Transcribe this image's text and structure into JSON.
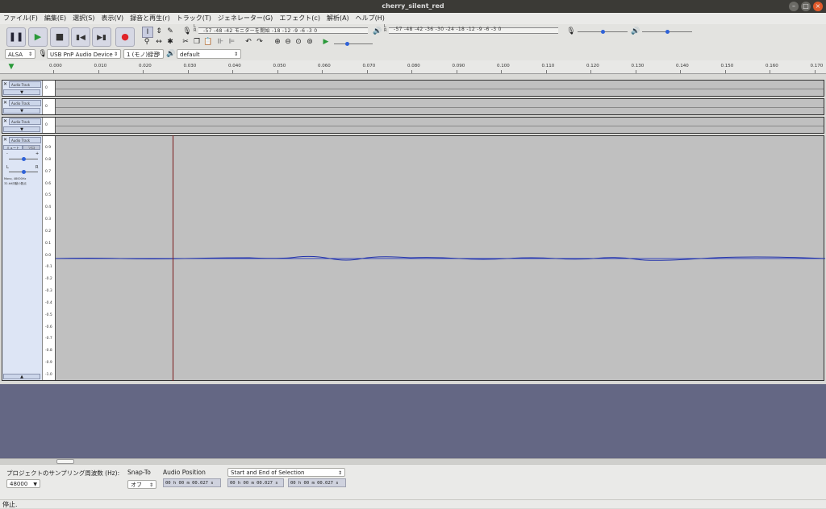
{
  "window": {
    "title": "cherry_silent_red"
  },
  "menu": [
    "ファイル(F)",
    "編集(E)",
    "選択(S)",
    "表示(V)",
    "録音と再生(r)",
    "トラック(T)",
    "ジェネレーター(G)",
    "エフェクト(c)",
    "解析(A)",
    "ヘルプ(H)"
  ],
  "meters": {
    "record_scale": "-57  -48  -42  モニターを開始  -18  -12 -9 -6 -3 0",
    "playback_scale": "-57  -48  -42  -36  -30  -24  -18  -12 -9 -6 -3 0",
    "record_level": 0.5,
    "playback_level": 0.5,
    "lr_label": "L\nR"
  },
  "device": {
    "host": "ALSA",
    "recording_device": "USB PnP Audio Device",
    "channels": "1 (モノ)録音",
    "playback_device": "default"
  },
  "ruler": [
    "0.000",
    "0.010",
    "0.020",
    "0.030",
    "0.040",
    "0.050",
    "0.060",
    "0.070",
    "0.080",
    "0.090",
    "0.100",
    "0.110",
    "0.120",
    "0.130",
    "0.140",
    "0.150",
    "0.160",
    "0.170"
  ],
  "tracks": [
    {
      "name": "Audio Track",
      "scale_label": "0",
      "collapse": "▼"
    },
    {
      "name": "Audio Track",
      "scale_label": "0",
      "collapse": "▼"
    },
    {
      "name": "Audio Track",
      "scale_label": "0",
      "collapse": "▼"
    },
    {
      "name": "Audio Track",
      "mute_label": "ミュート",
      "solo_label": "ソロ",
      "gain_minus": "-",
      "gain_plus": "+",
      "pan_left": "L",
      "pan_right": "R",
      "info_line1": "Mono, 48000Hz",
      "info_line2": "32-bit浮動小数点",
      "collapse": "▲",
      "scale": [
        "0.9",
        "0.8",
        "0.7",
        "0.6",
        "0.5",
        "0.4",
        "0.3",
        "0.2",
        "0.1",
        "0.0",
        "-0.1",
        "-0.2",
        "-0.3",
        "-0.4",
        "-0.5",
        "-0.6",
        "-0.7",
        "-0.8",
        "-0.9",
        "-1.0"
      ]
    }
  ],
  "selection_toolbar": {
    "rate_label": "プロジェクトのサンプリング周波数 (Hz):",
    "rate_value": "48000",
    "snap_label": "Snap-To",
    "snap_value": "オフ",
    "position_label": "Audio Position",
    "position_value": "00 h 00 m 00.027 s",
    "selection_mode": "Start and End of Selection",
    "sel_start": "00 h 00 m 00.027 s",
    "sel_end": "00 h 00 m 00.027 s"
  },
  "status": "停止."
}
